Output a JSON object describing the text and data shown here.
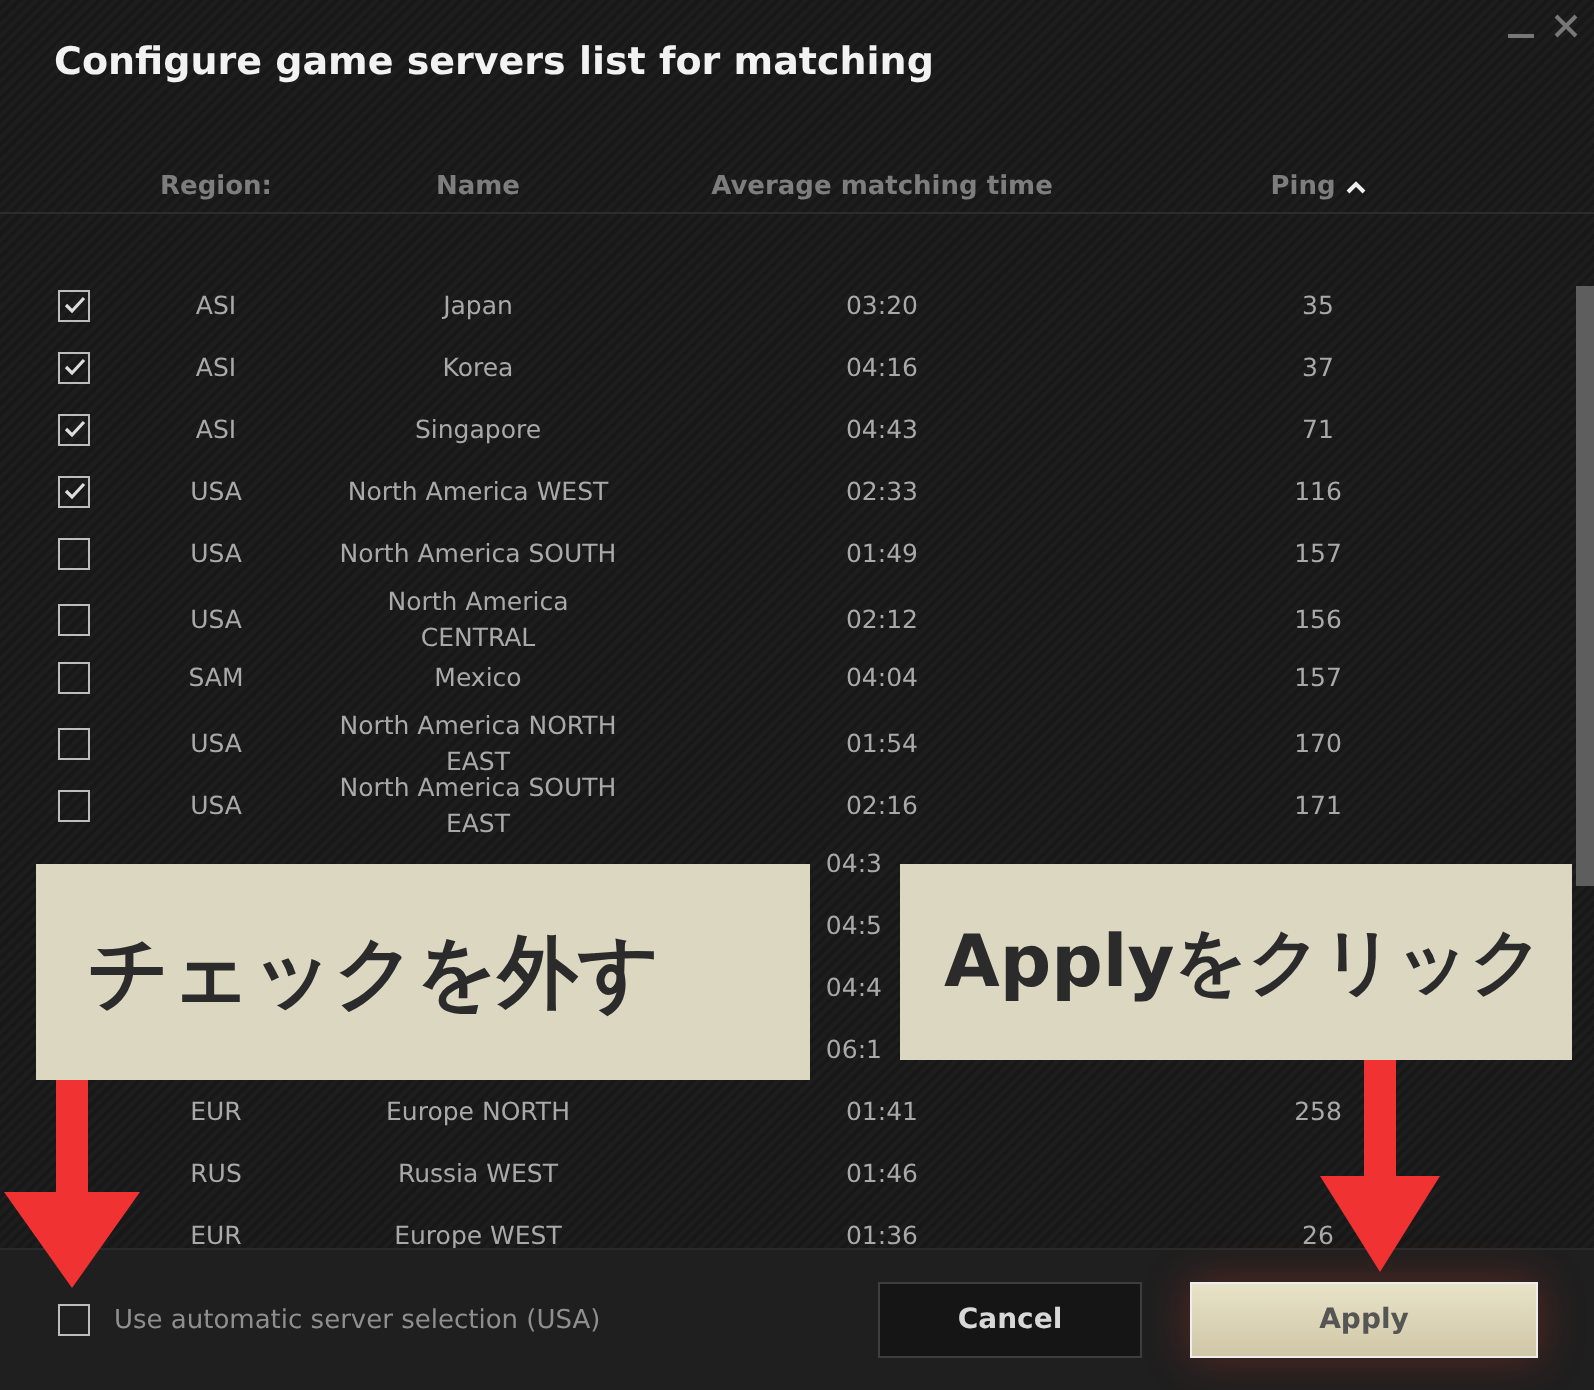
{
  "window": {
    "title": "Configure game servers list for matching"
  },
  "columns": [
    {
      "label": "Region:"
    },
    {
      "label": "Name"
    },
    {
      "label": "Average matching time"
    },
    {
      "label": "Ping",
      "sorted": true
    }
  ],
  "rows": [
    {
      "checked": true,
      "region": "ASI",
      "name": "Japan",
      "time": "03:20",
      "ping": "35"
    },
    {
      "checked": true,
      "region": "ASI",
      "name": "Korea",
      "time": "04:16",
      "ping": "37"
    },
    {
      "checked": true,
      "region": "ASI",
      "name": "Singapore",
      "time": "04:43",
      "ping": "71"
    },
    {
      "checked": true,
      "region": "USA",
      "name": "North America WEST",
      "time": "02:33",
      "ping": "116"
    },
    {
      "checked": false,
      "region": "USA",
      "name": "North America SOUTH",
      "time": "01:49",
      "ping": "157"
    },
    {
      "checked": false,
      "region": "USA",
      "name": "North America CENTRAL",
      "time": "02:12",
      "ping": "156"
    },
    {
      "checked": false,
      "region": "SAM",
      "name": "Mexico",
      "time": "04:04",
      "ping": "157"
    },
    {
      "checked": false,
      "region": "USA",
      "name": "North America NORTH EAST",
      "time": "01:54",
      "ping": "170"
    },
    {
      "checked": false,
      "region": "USA",
      "name": "North America SOUTH EAST",
      "time": "02:16",
      "ping": "171"
    },
    {
      "time": "04:3"
    },
    {
      "time": "04:5"
    },
    {
      "time": "04:4"
    },
    {
      "time": "06:1"
    },
    {
      "region": "EUR",
      "name": "Europe NORTH",
      "time": "01:41",
      "ping": "258"
    },
    {
      "region": "RUS",
      "name": "Russia WEST",
      "time": "01:46"
    },
    {
      "region": "EUR",
      "name": "Europe WEST",
      "time": "01:36",
      "ping": "26"
    }
  ],
  "auto_select": {
    "label": "Use automatic server selection (USA)",
    "checked": false
  },
  "buttons": [
    {
      "label": "Cancel",
      "kind": "secondary"
    },
    {
      "label": "Apply",
      "kind": "primary"
    }
  ],
  "callouts": [
    {
      "text": "チェックを外す"
    },
    {
      "text": "Applyをクリック"
    }
  ]
}
